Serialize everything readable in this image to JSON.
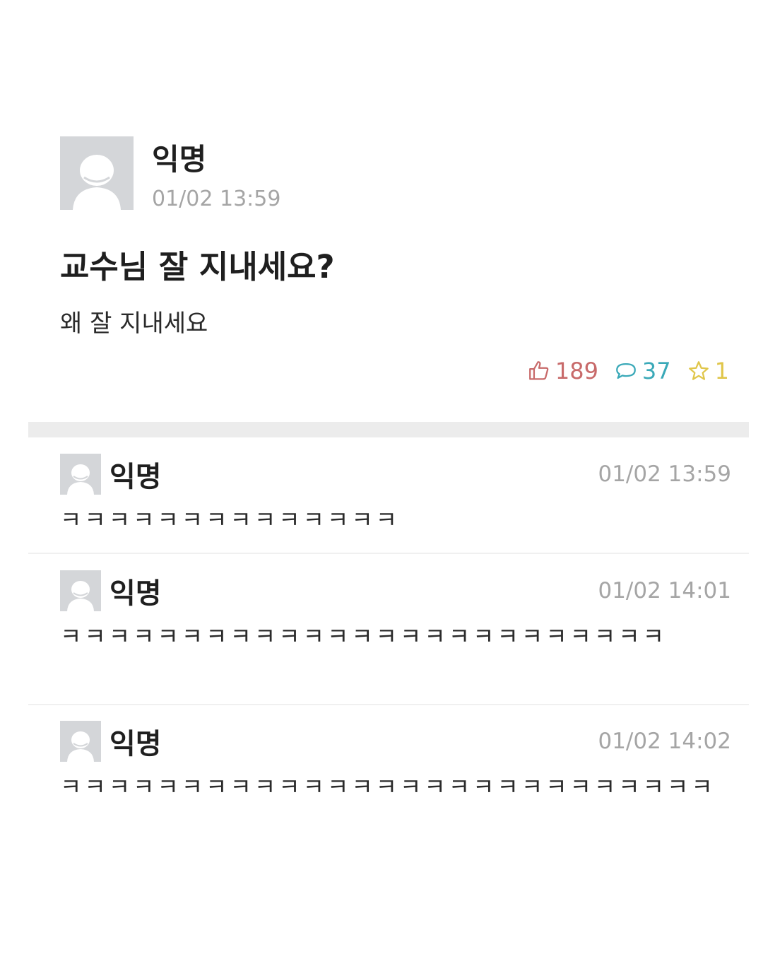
{
  "post": {
    "author": "익명",
    "time": "01/02 13:59",
    "title": "교수님 잘 지내세요?",
    "body": "왜 잘 지내세요",
    "likes": "189",
    "comments": "37",
    "scraps": "1"
  },
  "comments": [
    {
      "author": "익명",
      "time": "01/02 13:59",
      "text": "ㅋㅋㅋㅋㅋㅋㅋㅋㅋㅋㅋㅋㅋㅋ"
    },
    {
      "author": "익명",
      "time": "01/02 14:01",
      "text": "ㅋㅋㅋㅋㅋㅋㅋㅋㅋㅋㅋㅋㅋㅋㅋㅋㅋㅋㅋㅋㅋㅋㅋㅋㅋ"
    },
    {
      "author": "익명",
      "time": "01/02 14:02",
      "text": "ㅋㅋㅋㅋㅋㅋㅋㅋㅋㅋㅋㅋㅋㅋㅋㅋㅋㅋㅋㅋㅋㅋㅋㅋㅋㅋㅋ"
    }
  ],
  "icons": {
    "avatar": "default-user-avatar-icon",
    "like": "thumbs-up-icon",
    "comment": "speech-bubble-icon",
    "scrap": "star-icon"
  },
  "colors": {
    "like": "#c86a6a",
    "comment": "#3aa9b8",
    "scrap": "#e0c64a",
    "meta": "#a5a5a5"
  }
}
